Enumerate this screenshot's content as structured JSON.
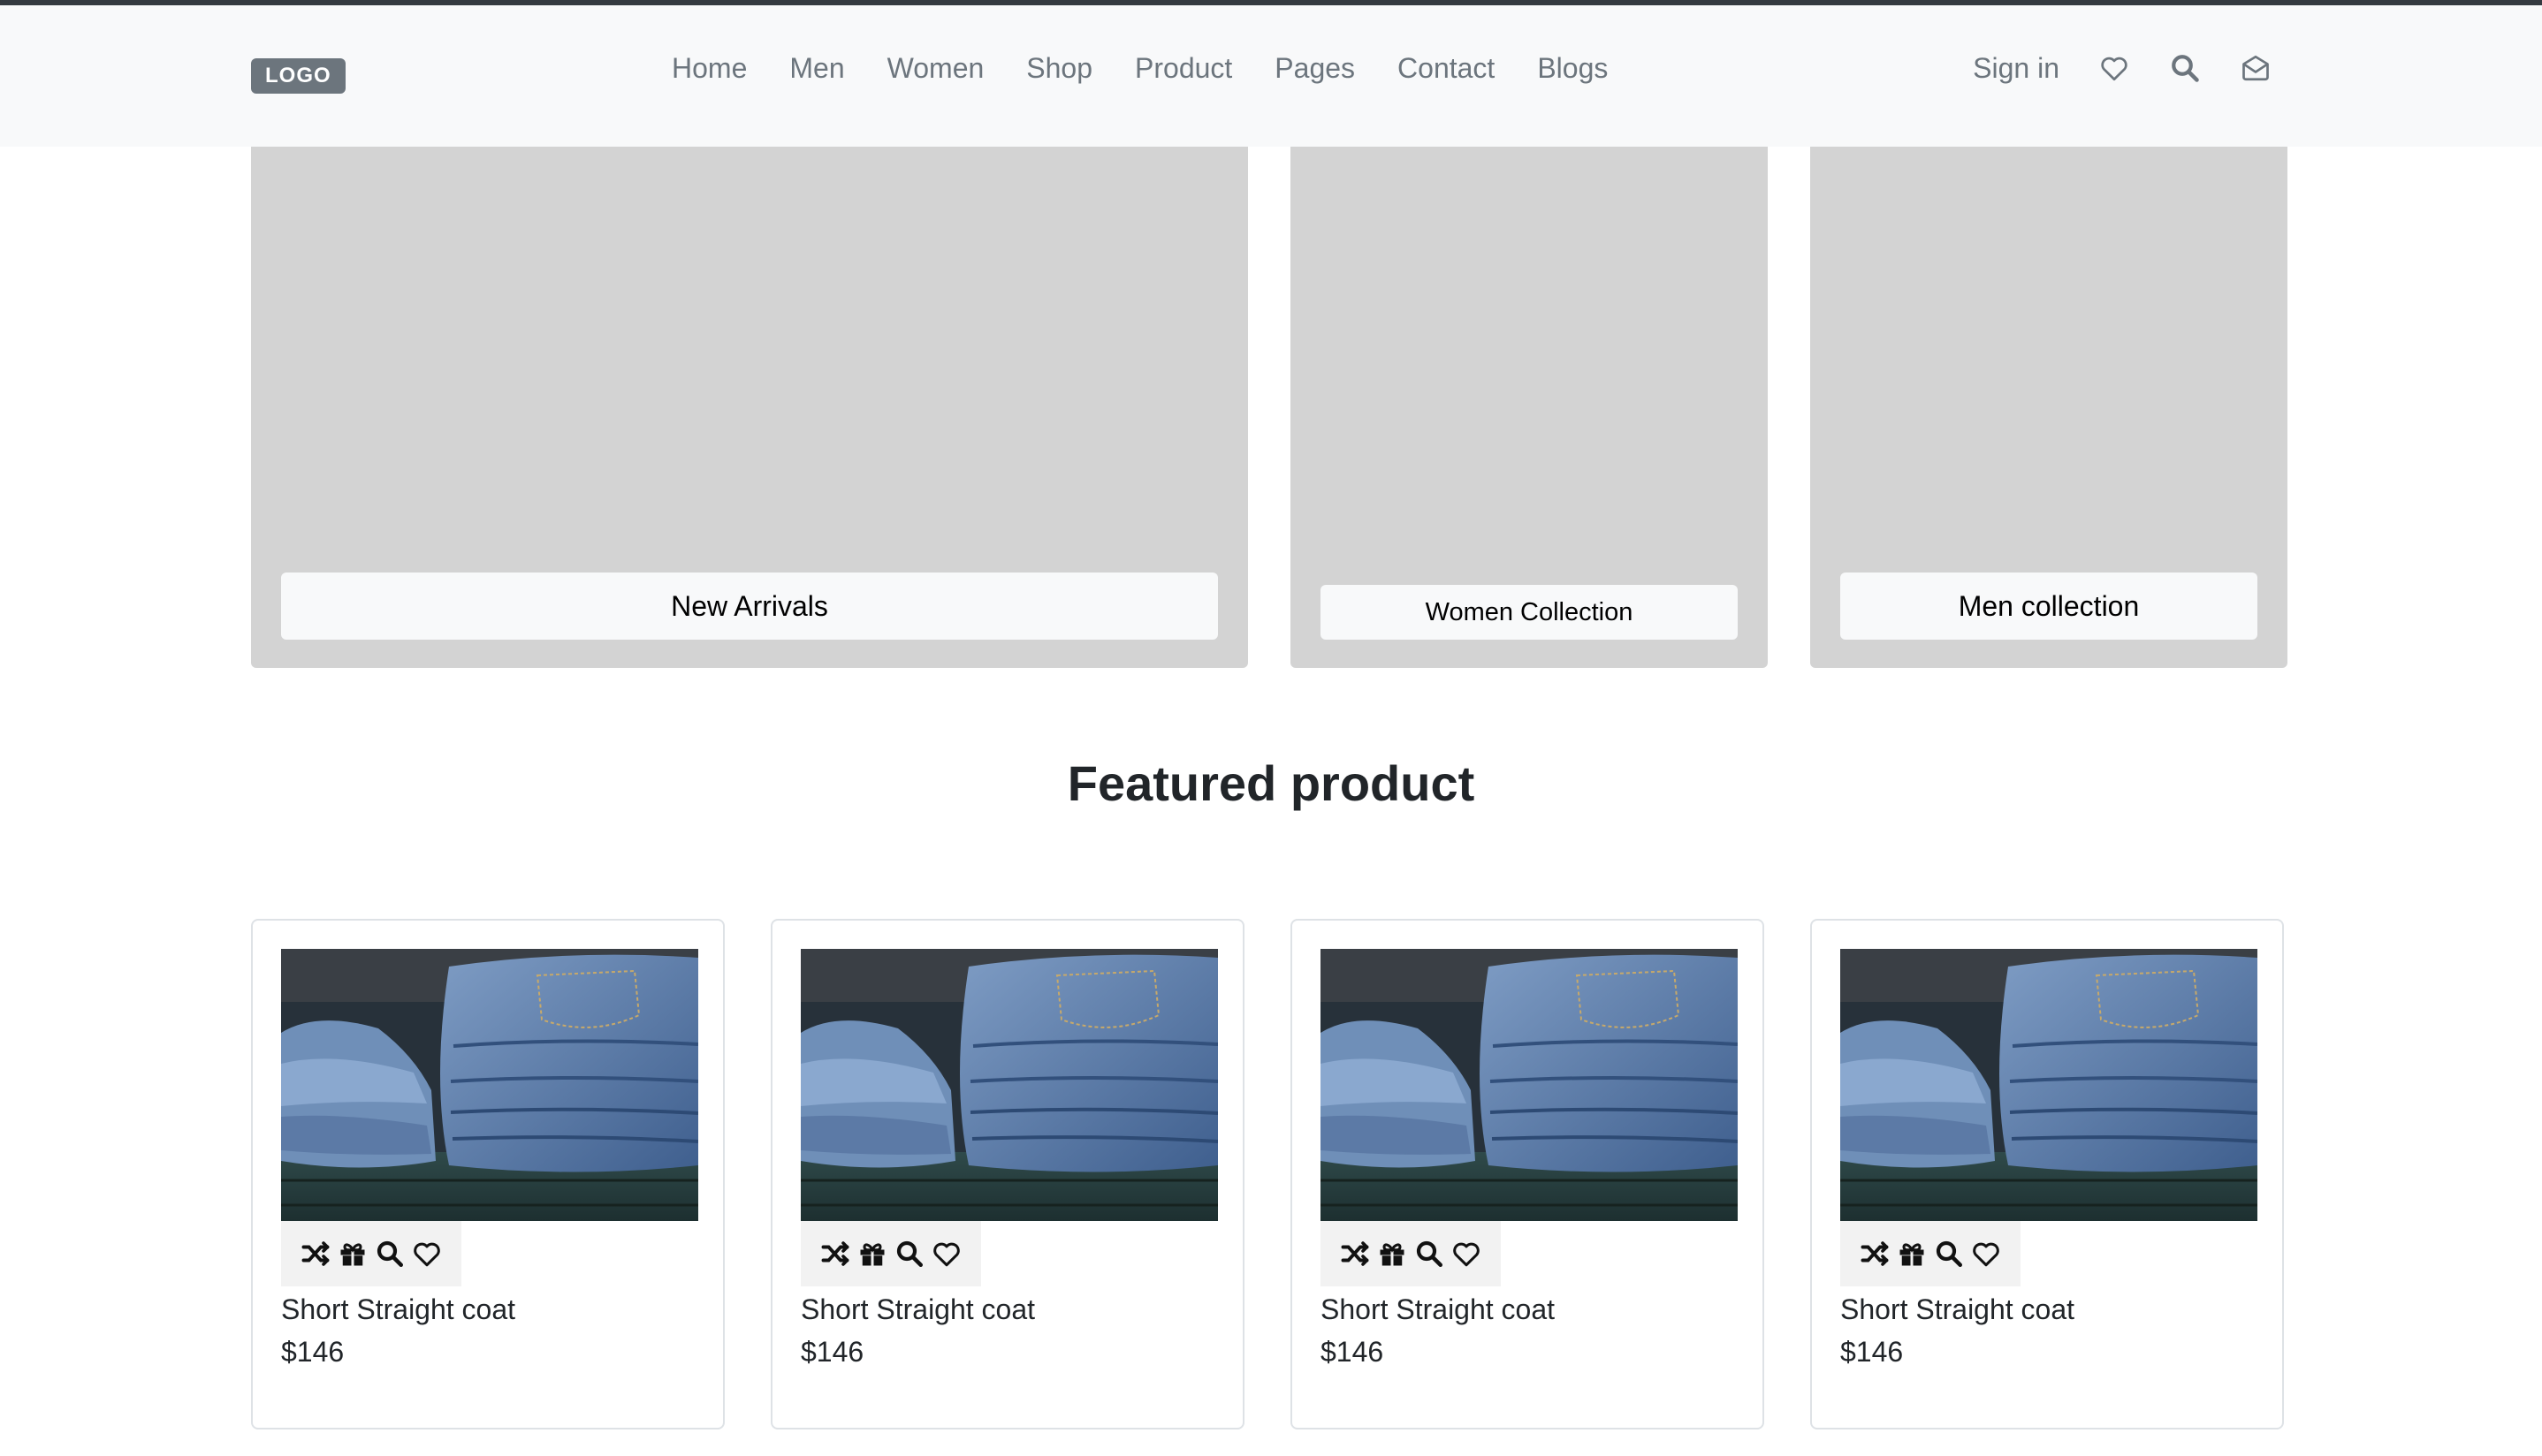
{
  "header": {
    "logo": "LOGO",
    "nav": [
      "Home",
      "Men",
      "Women",
      "Shop",
      "Product",
      "Pages",
      "Contact",
      "Blogs"
    ],
    "sign_in": "Sign in",
    "icons": [
      "heart-icon",
      "search-icon",
      "envelope-icon"
    ]
  },
  "banners": [
    {
      "label": "New Arrivals"
    },
    {
      "label": "Women Collection"
    },
    {
      "label": "Men collection"
    }
  ],
  "featured": {
    "title": "Featured product",
    "card_icons": [
      "shuffle-icon",
      "gift-icon",
      "search-icon",
      "heart-icon"
    ],
    "products": [
      {
        "name": "Short Straight coat",
        "price": "$146"
      },
      {
        "name": "Short Straight coat",
        "price": "$146"
      },
      {
        "name": "Short Straight coat",
        "price": "$146"
      },
      {
        "name": "Short Straight coat",
        "price": "$146"
      }
    ]
  },
  "colors": {
    "navbar_bg": "#f8f9fa",
    "banner_bg": "#d3d3d3",
    "muted_text": "#6c757d",
    "logo_bg": "#6c757d"
  }
}
